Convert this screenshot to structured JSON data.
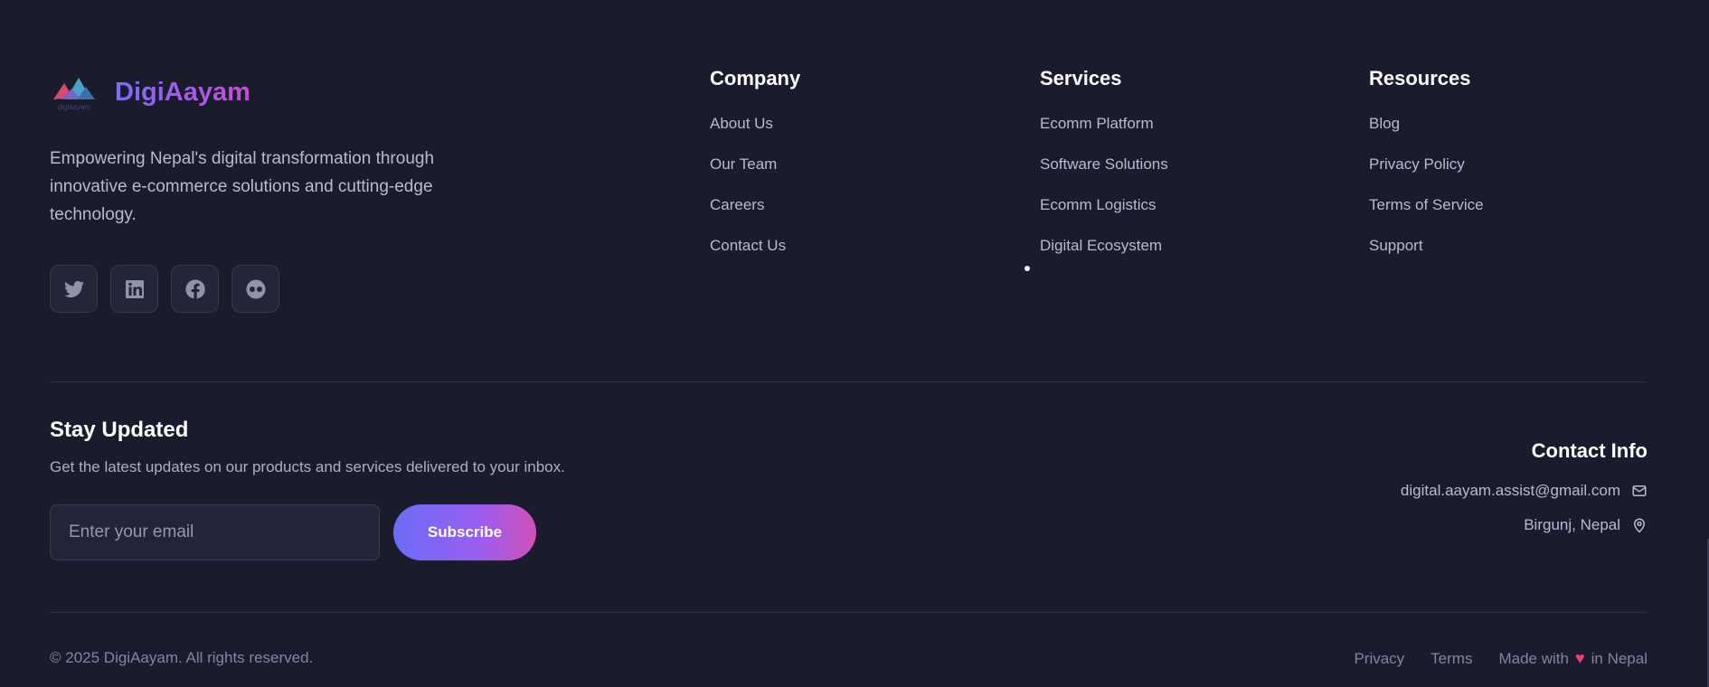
{
  "brand": {
    "name": "DigiAayam",
    "logo_text": "digiaayam",
    "tagline": "Empowering Nepal's digital transformation through innovative e-commerce solutions and cutting-edge technology."
  },
  "socials": [
    {
      "name": "twitter-icon"
    },
    {
      "name": "linkedin-icon"
    },
    {
      "name": "facebook-icon"
    },
    {
      "name": "flickr-icon"
    }
  ],
  "columns": {
    "company": {
      "title": "Company",
      "items": [
        "About Us",
        "Our Team",
        "Careers",
        "Contact Us"
      ]
    },
    "services": {
      "title": "Services",
      "items": [
        "Ecomm Platform",
        "Software Solutions",
        "Ecomm Logistics",
        "Digital Ecosystem"
      ]
    },
    "resources": {
      "title": "Resources",
      "items": [
        "Blog",
        "Privacy Policy",
        "Terms of Service",
        "Support"
      ]
    }
  },
  "newsletter": {
    "title": "Stay Updated",
    "description": "Get the latest updates on our products and services delivered to your inbox.",
    "placeholder": "Enter your email",
    "button": "Subscribe"
  },
  "contact": {
    "title": "Contact Info",
    "email": "digital.aayam.assist@gmail.com",
    "location": "Birgunj, Nepal"
  },
  "bottom": {
    "copyright": "© 2025 DigiAayam. All rights reserved.",
    "links": [
      "Privacy",
      "Terms"
    ],
    "made_prefix": "Made with",
    "made_suffix": "in Nepal"
  },
  "colors": {
    "background": "#1b1b2e",
    "accent_start": "#6b6cf7",
    "accent_end": "#d14fb8",
    "heart": "#ee3f74"
  }
}
